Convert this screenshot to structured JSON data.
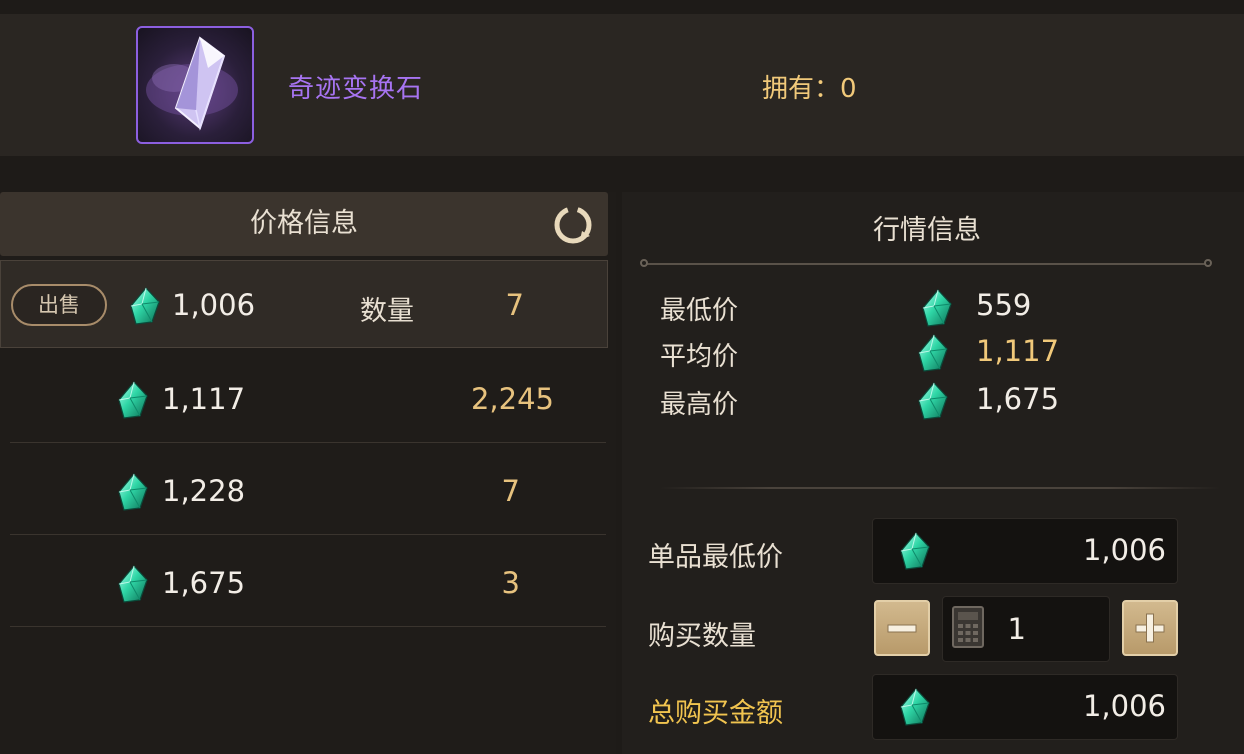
{
  "item": {
    "name": "奇迹变换石",
    "owned_text": "拥有：0",
    "icon": "crystal-stone-icon"
  },
  "price_panel": {
    "title": "价格信息",
    "refresh_icon": "refresh-icon",
    "sell_label": "出售",
    "qty_label": "数量",
    "currency_icon": "green-gem-icon",
    "rows": [
      {
        "price": "1,006",
        "qty": "7"
      },
      {
        "price": "1,117",
        "qty": "2,245"
      },
      {
        "price": "1,228",
        "qty": "7"
      },
      {
        "price": "1,675",
        "qty": "3"
      }
    ]
  },
  "market_panel": {
    "title": "行情信息",
    "stats": [
      {
        "label": "最低价",
        "value": "559"
      },
      {
        "label": "平均价",
        "value": "1,117"
      },
      {
        "label": "最高价",
        "value": "1,675"
      }
    ]
  },
  "purchase": {
    "unit_min_label": "单品最低价",
    "unit_min_value": "1,006",
    "qty_label": "购买数量",
    "qty_value": "1",
    "total_label": "总购买金额",
    "total_value": "1,006"
  },
  "colors": {
    "item_name": "#a774f2",
    "gold": "#f1c97a",
    "gem": "#2fd6a6"
  }
}
